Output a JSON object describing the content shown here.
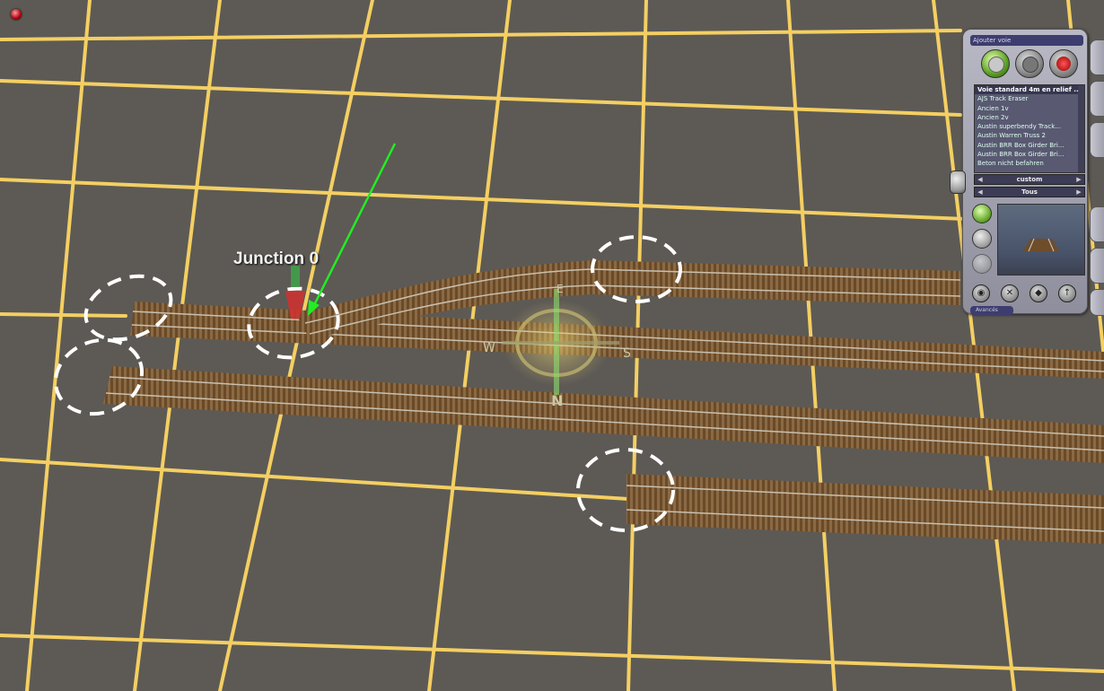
{
  "scene": {
    "junction_label": "Junction 0",
    "compass": {
      "n": "N",
      "e": "E",
      "s": "S",
      "w": "W"
    },
    "colors": {
      "ground": "#5d5a55",
      "grid": "#f4cf62",
      "arrow": "#22ee22",
      "ballast": "#6e4d2a"
    }
  },
  "panel": {
    "title": "Ajouter voie",
    "mode_buttons": [
      {
        "name": "add-track-mode",
        "icon": "track-add-icon"
      },
      {
        "name": "track-spline-mode",
        "icon": "spline-icon"
      },
      {
        "name": "track-object-mode",
        "icon": "marker-icon"
      }
    ],
    "track_list": {
      "selected": "Voie standard 4m en relief ...",
      "items": [
        "AJS Track Eraser",
        "Ancien 1v",
        "Ancien 2v",
        "Austin superbendy Track...",
        "Austin Warren Truss 2",
        "Austin BRR Box Girder Bri...",
        "Austin BRR Box Girder Bri...",
        "Beton nicht befahren"
      ]
    },
    "filter_one": "custom",
    "filter_two": "Tous",
    "advanced_tab": "Avancés"
  }
}
